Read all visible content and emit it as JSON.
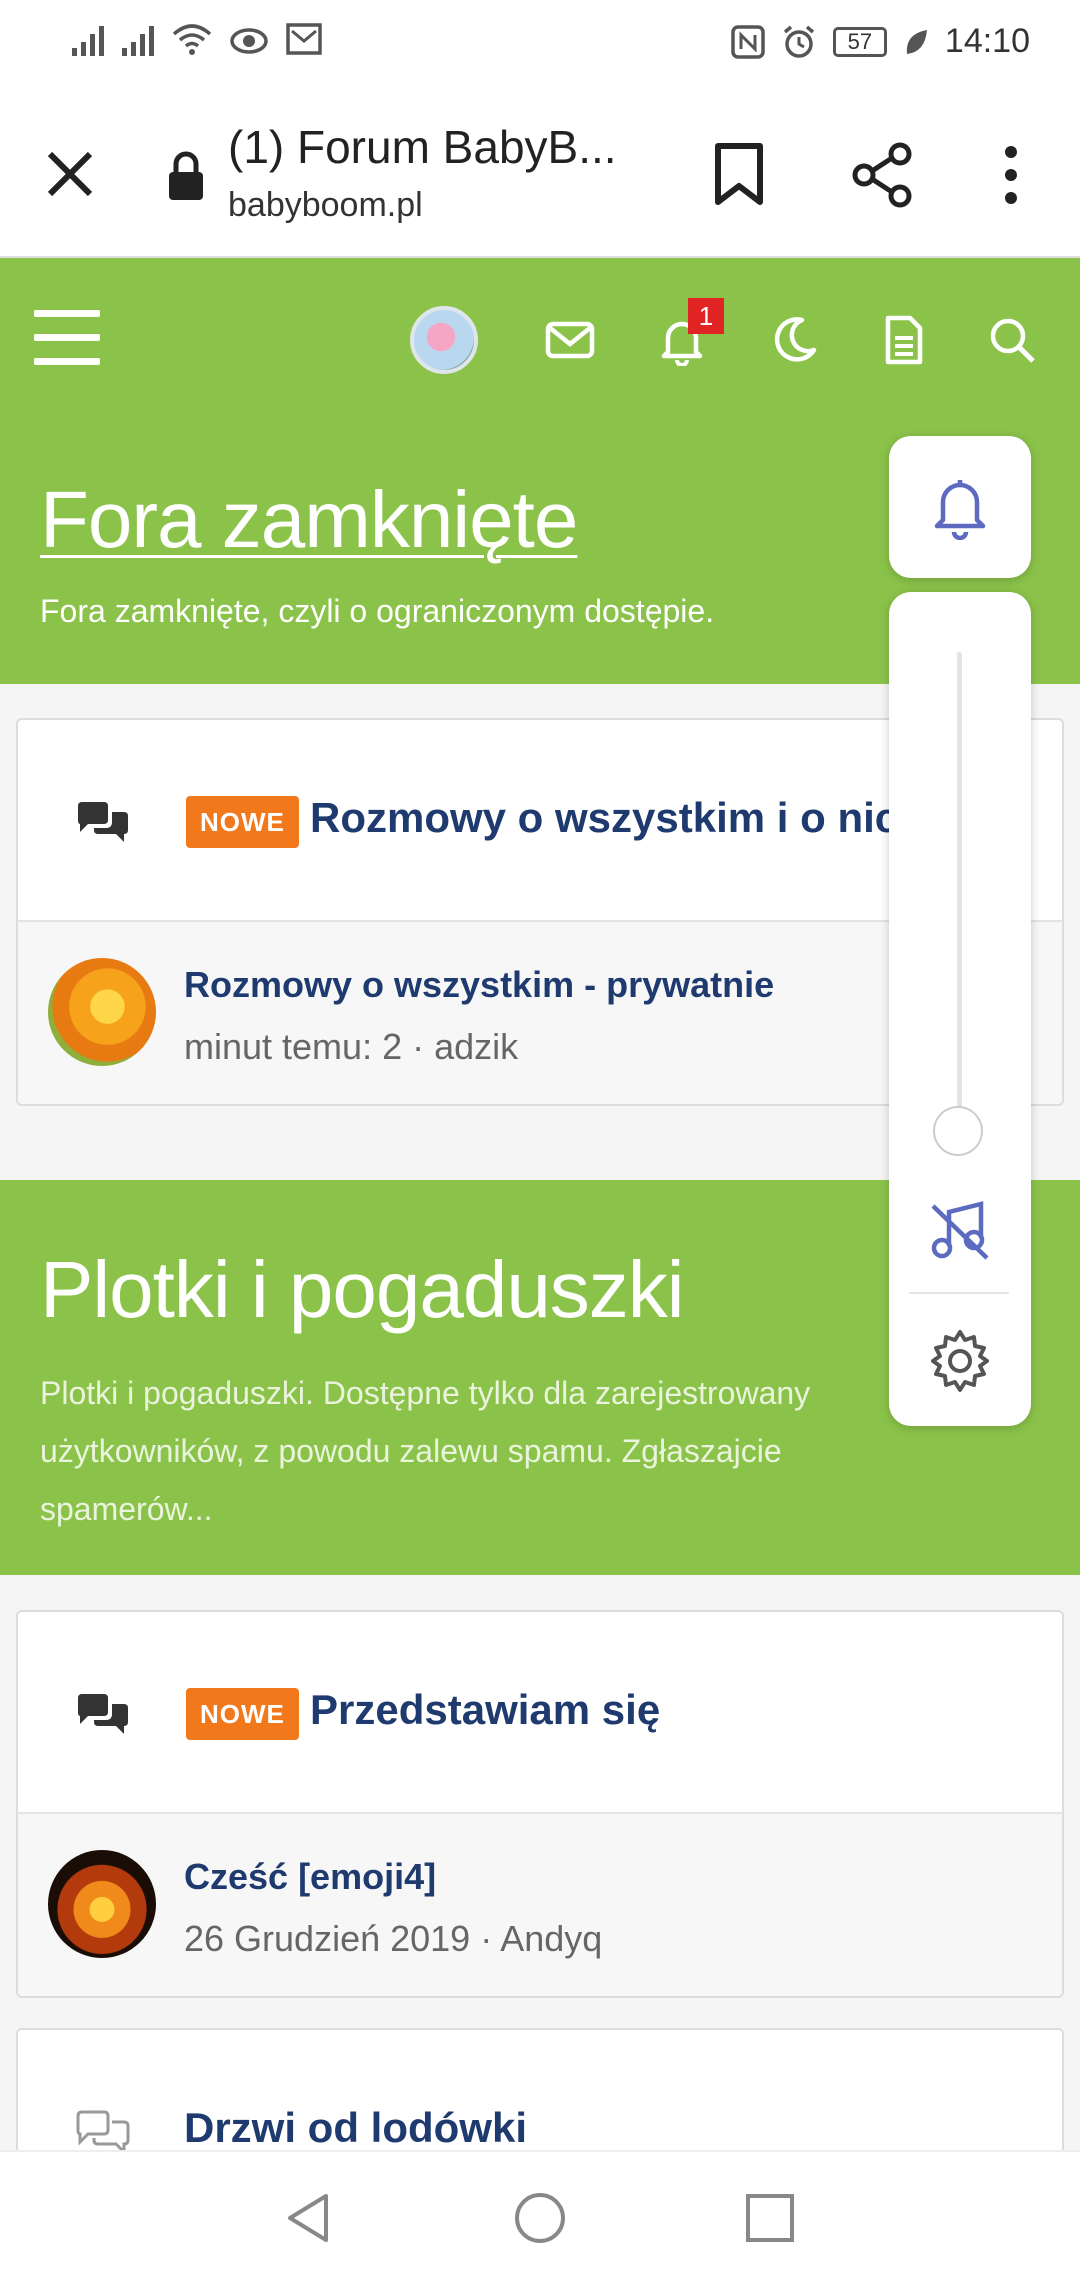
{
  "status_bar": {
    "time": "14:10",
    "battery": "57",
    "icons": [
      "signal-icon",
      "signal-icon",
      "wifi-icon",
      "eye-icon",
      "mail-icon",
      "nfc-icon",
      "alarm-icon",
      "battery-icon",
      "leaf-icon"
    ]
  },
  "browser": {
    "title": "(1) Forum BabyB...",
    "url": "babyboom.pl",
    "icons": [
      "close-icon",
      "lock-icon",
      "bookmark-icon",
      "share-icon",
      "more-icon"
    ]
  },
  "header": {
    "notification_count": "1",
    "icons": [
      "menu-icon",
      "avatar",
      "envelope-icon",
      "bell-icon",
      "moon-icon",
      "document-icon",
      "search-icon"
    ]
  },
  "sections": [
    {
      "title": "Fora zamknięte",
      "description": "Fora zamknięte, czyli o ograniczonym dostępie.",
      "forums": [
        {
          "badge": "NOWE",
          "title": "Rozmowy o wszystkim i o nic",
          "last_post_title": "Rozmowy o wszystkim - prywatnie",
          "last_post_meta": "minut temu: 2 · adzik"
        }
      ]
    },
    {
      "title": "Plotki i pogaduszki",
      "description": "Plotki i pogaduszki. Dostępne tylko dla zarejestrowany użytkowników, z powodu zalewu spamu. Zgłaszajcie spamerów...",
      "forums": [
        {
          "badge": "NOWE",
          "title": "Przedstawiam się",
          "last_post_title": "Cześć [emoji4]",
          "last_post_meta": "26 Grudzień 2019 · Andyq"
        },
        {
          "badge": "",
          "title": "Drzwi od lodówki"
        }
      ]
    }
  ],
  "notification_panel": {
    "icons": [
      "bell-icon",
      "music-off-icon",
      "gear-icon"
    ],
    "slider_level": 0
  },
  "colors": {
    "green": "#8bc34a",
    "navy": "#1e3a6e",
    "badge_orange": "#f2781c",
    "accent_blue": "#5c6bc0"
  }
}
